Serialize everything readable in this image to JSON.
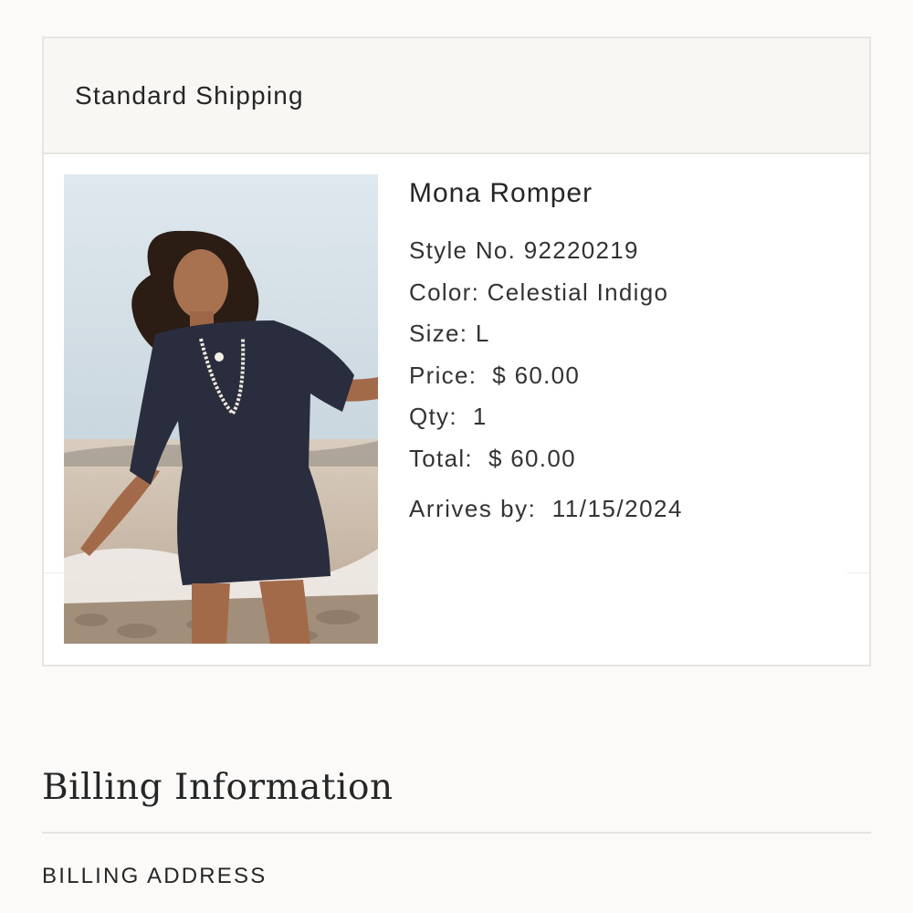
{
  "shipping": {
    "method": "Standard Shipping"
  },
  "product": {
    "name": "Mona Romper",
    "style": "Style No. 92220219",
    "color": "Color: Celestial Indigo",
    "size": "Size: L",
    "price": "Price:  $ 60.00",
    "qty": "Qty:  1",
    "total": "Total:  $ 60.00",
    "arrives": "Arrives by:  11/15/2024",
    "image": "product-photo-woman-in-navy-romper-on-beach"
  },
  "billing": {
    "title": "Billing Information",
    "address_label": "BILLING ADDRESS"
  },
  "colors": {
    "background": "#fcfaf9",
    "header_bg": "#f8f7f4",
    "border": "#e7e5e2",
    "text": "#262626",
    "romper": "#2a2d3d"
  }
}
